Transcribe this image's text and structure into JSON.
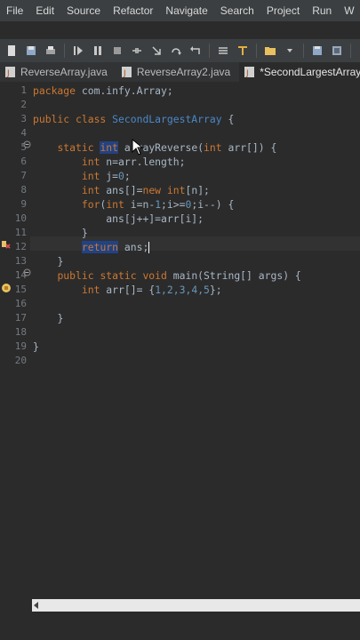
{
  "menu": [
    "File",
    "Edit",
    "Source",
    "Refactor",
    "Navigate",
    "Search",
    "Project",
    "Run",
    "W"
  ],
  "tabs": [
    {
      "label": "ReverseArray.java",
      "active": false
    },
    {
      "label": "ReverseArray2.java",
      "active": false
    },
    {
      "label": "*SecondLargestArray.java",
      "active": true
    }
  ],
  "line_numbers": [
    "1",
    "2",
    "3",
    "4",
    "5",
    "6",
    "7",
    "8",
    "9",
    "10",
    "11",
    "12",
    "13",
    "14",
    "15",
    "16",
    "17",
    "18",
    "19",
    "20"
  ],
  "code": {
    "l1_kw": "package",
    "l1_rest": " com.infy.Array;",
    "l3_kw": "public class",
    "l3_cls": "SecondLargestArray",
    "l3_rest": " {",
    "l5_kw": "static",
    "l5_sel": "int",
    "l5_rest": "arrayReverse",
    "l5_open": "(",
    "l5_kw2": "int",
    "l5_params": " arr[]) {",
    "l6_kw": "int",
    "l6_rest": " n=arr.length;",
    "l7_kw": "int",
    "l7_rest": " j=",
    "l7_num": "0",
    "l7_end": ";",
    "l8_kw": "int",
    "l8_rest": " ans[]=",
    "l8_kw2": "new int",
    "l8_end": "[n];",
    "l9_kw": "for",
    "l9_a": "(",
    "l9_kw2": "int",
    "l9_b": " i=n-",
    "l9_n1": "1",
    "l9_c": ";i>=",
    "l9_n2": "0",
    "l9_d": ";i--) {",
    "l10": "ans[j++]=arr[i];",
    "l11": "}",
    "l12_sel": "return",
    "l12_rest": " ans;",
    "l13": "}",
    "l14_kw": "public static void",
    "l14_rest": " main(String[] args) {",
    "l15_kw": "int",
    "l15_rest": " arr[]= {",
    "l15_nums": "1,2,3,4,5",
    "l15_end": "};",
    "l17": "}",
    "l19": "}"
  },
  "colors": {
    "keyword": "#cc7832",
    "class_name": "#4a88c7",
    "number": "#6897bb",
    "text": "#a9b7c6",
    "selection": "#214283"
  }
}
